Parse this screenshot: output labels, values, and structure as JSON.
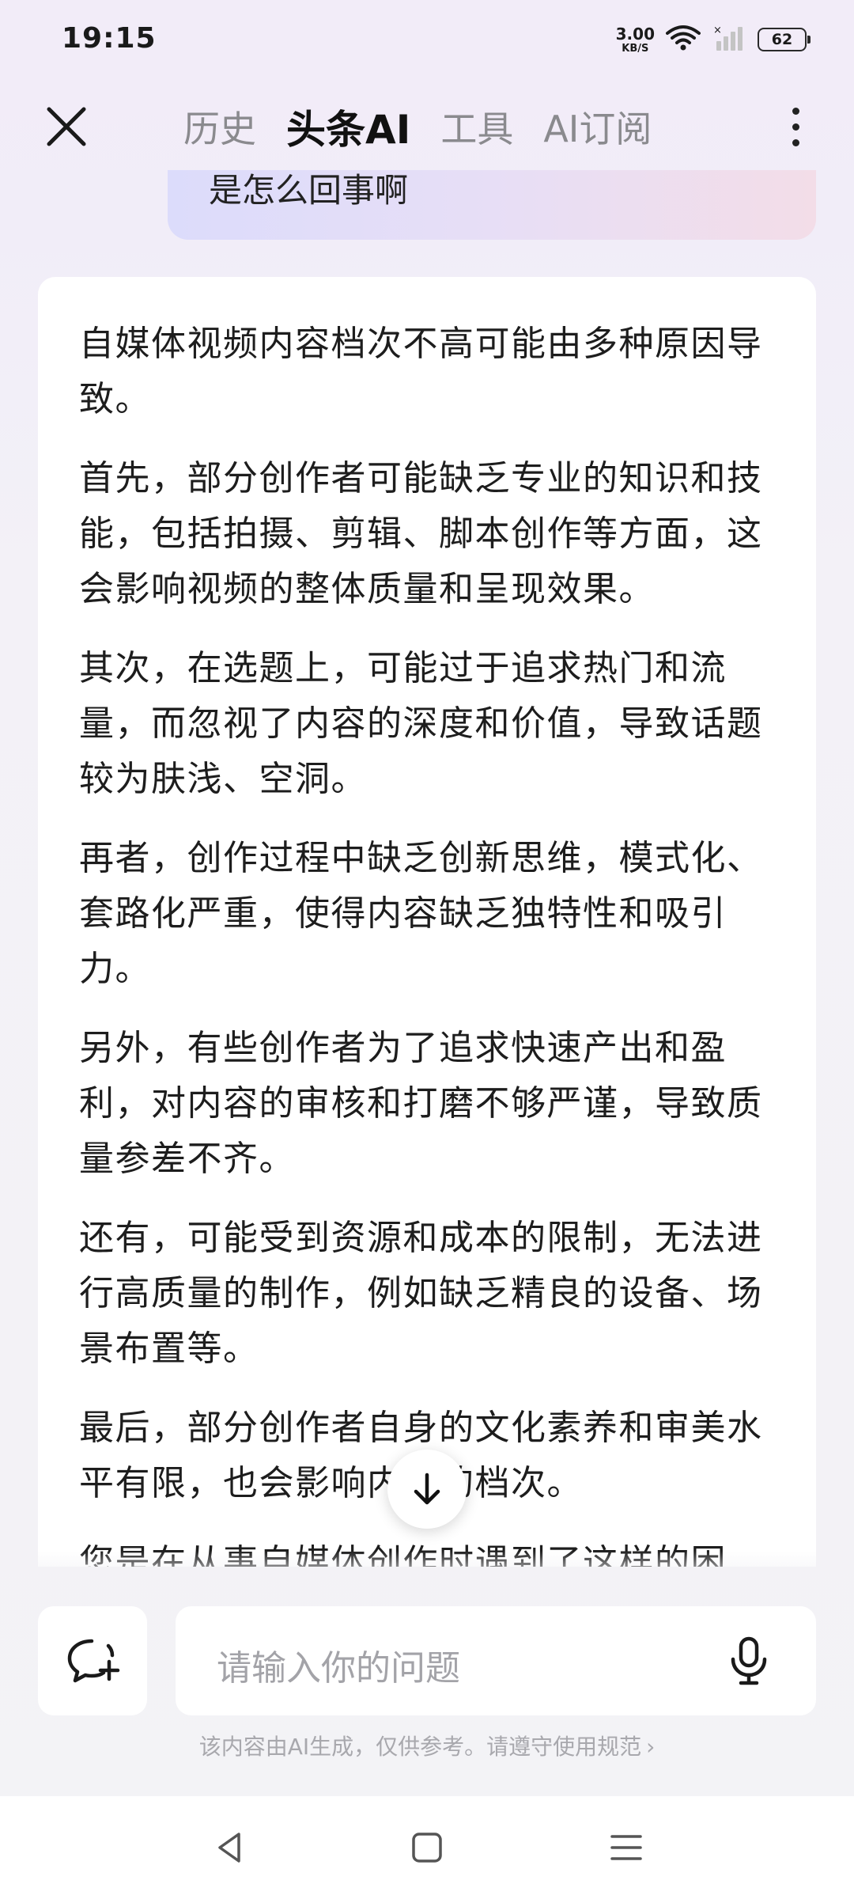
{
  "status_bar": {
    "time": "19:15",
    "net_speed": "3.00",
    "net_unit": "KB/S",
    "battery": "62"
  },
  "nav": {
    "tabs": [
      {
        "label": "历史",
        "active": false
      },
      {
        "label": "头条AI",
        "active": true
      },
      {
        "label": "工具",
        "active": false
      },
      {
        "label": "AI订阅",
        "active": false
      }
    ]
  },
  "chat": {
    "user_message": "是怎么回事啊",
    "answer_paragraphs": [
      "自媒体视频内容档次不高可能由多种原因导致。",
      "首先，部分创作者可能缺乏专业的知识和技能，包括拍摄、剪辑、脚本创作等方面，这会影响视频的整体质量和呈现效果。",
      "其次，在选题上，可能过于追求热门和流量，而忽视了内容的深度和价值，导致话题较为肤浅、空洞。",
      "再者，创作过程中缺乏创新思维，模式化、套路化严重，使得内容缺乏独特性和吸引力。",
      "另外，有些创作者为了追求快速产出和盈利，对内容的审核和打磨不够严谨，导致质量参差不齐。",
      "还有，可能受到资源和成本的限制，无法进行高质量的制作，例如缺乏精良的设备、场景布置等。",
      "最后，部分创作者自身的文化素养和审美水平有限，也会影响内容的档次。",
      "您是在从事自媒体创作时遇到了这样的困"
    ]
  },
  "input": {
    "placeholder": "请输入你的问题"
  },
  "disclaimer": "该内容由AI生成，仅供参考。请遵守使用规范",
  "icons": {
    "close": "close-icon",
    "more": "more-vertical-icon",
    "scroll_down": "arrow-down-icon",
    "new_chat": "chat-plus-icon",
    "mic": "microphone-icon",
    "wifi": "wifi-icon",
    "signal": "signal-icon",
    "back": "back-triangle-icon",
    "home": "home-square-icon",
    "menu": "menu-lines-icon"
  },
  "colors": {
    "active_tab": "#111111",
    "inactive_tab": "#8a8a8e",
    "placeholder": "#a3a3a8",
    "card_bg": "#ffffff"
  }
}
